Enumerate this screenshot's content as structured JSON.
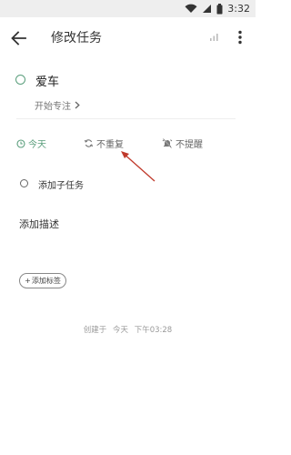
{
  "status_bar": {
    "time": "3:32"
  },
  "app_bar": {
    "title": "修改任务"
  },
  "task": {
    "title": "爱车",
    "focus_label": "开始专注"
  },
  "options": {
    "date": "今天",
    "repeat": "不重复",
    "remind": "不提醒"
  },
  "subtask": {
    "add_label": "添加子任务"
  },
  "description": {
    "placeholder": "添加描述"
  },
  "tag": {
    "add_label": "添加标签"
  },
  "footer": {
    "created_prefix": "创建于",
    "created_day": "今天",
    "created_time": "下午03:28"
  },
  "colors": {
    "accent": "#5a9e7c",
    "arrow": "#c0392b"
  }
}
